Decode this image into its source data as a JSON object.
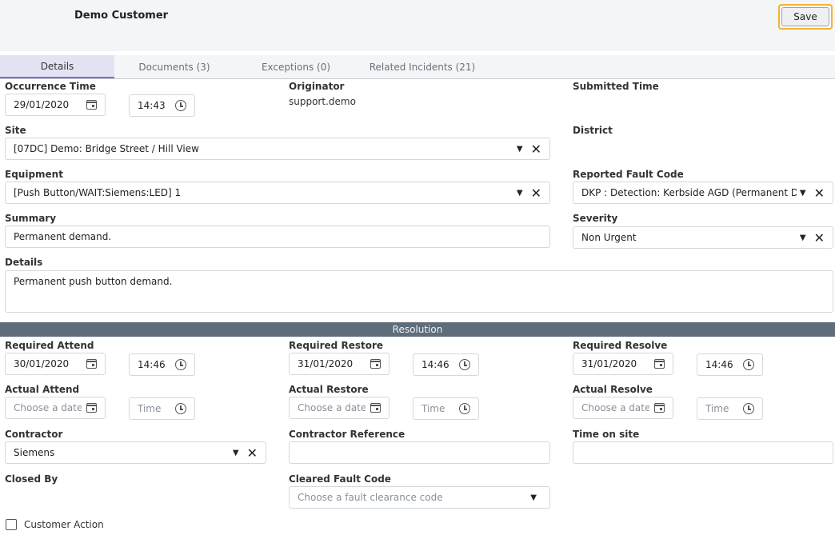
{
  "header": {
    "customer": "Demo Customer",
    "save_label": "Save"
  },
  "tabs": [
    {
      "label": "Details",
      "active": true
    },
    {
      "label": "Documents (3)",
      "active": false
    },
    {
      "label": "Exceptions (0)",
      "active": false
    },
    {
      "label": "Related Incidents (21)",
      "active": false
    }
  ],
  "occurrence": {
    "label": "Occurrence Time",
    "date": "29/01/2020",
    "time": "14:43"
  },
  "originator": {
    "label": "Originator",
    "value": "support.demo"
  },
  "submitted": {
    "label": "Submitted Time"
  },
  "site": {
    "label": "Site",
    "value": "[07DC] Demo: Bridge Street  / Hill View"
  },
  "district": {
    "label": "District"
  },
  "equipment": {
    "label": "Equipment",
    "value": "[Push Button/WAIT:Siemens:LED] 1"
  },
  "fault_code": {
    "label": "Reported Fault Code",
    "value": "DKP : Detection: Kerbside AGD (Permanent Dem"
  },
  "summary": {
    "label": "Summary",
    "value": "Permanent demand."
  },
  "severity": {
    "label": "Severity",
    "value": "Non Urgent"
  },
  "details": {
    "label": "Details",
    "value": "Permanent push button demand."
  },
  "resolution": {
    "title": "Resolution",
    "required_attend": {
      "label": "Required Attend",
      "date": "30/01/2020",
      "time": "14:46"
    },
    "required_restore": {
      "label": "Required Restore",
      "date": "31/01/2020",
      "time": "14:46"
    },
    "required_resolve": {
      "label": "Required Resolve",
      "date": "31/01/2020",
      "time": "14:46"
    },
    "actual_attend": {
      "label": "Actual Attend"
    },
    "actual_restore": {
      "label": "Actual Restore"
    },
    "actual_resolve": {
      "label": "Actual Resolve"
    },
    "date_placeholder": "Choose a date",
    "time_placeholder": "Time",
    "contractor": {
      "label": "Contractor",
      "value": "Siemens"
    },
    "contractor_reference": {
      "label": "Contractor Reference",
      "value": ""
    },
    "time_on_site": {
      "label": "Time on site",
      "value": ""
    },
    "closed_by": {
      "label": "Closed By"
    },
    "cleared_fault_code": {
      "label": "Cleared Fault Code",
      "placeholder": "Choose a fault clearance code"
    },
    "customer_action": {
      "label": "Customer Action",
      "checked": false
    }
  },
  "icons": {
    "calendar": "calendar-icon",
    "clock": "clock-icon",
    "dropdown": "dropdown-caret-icon",
    "clear": "clear-x-icon"
  }
}
